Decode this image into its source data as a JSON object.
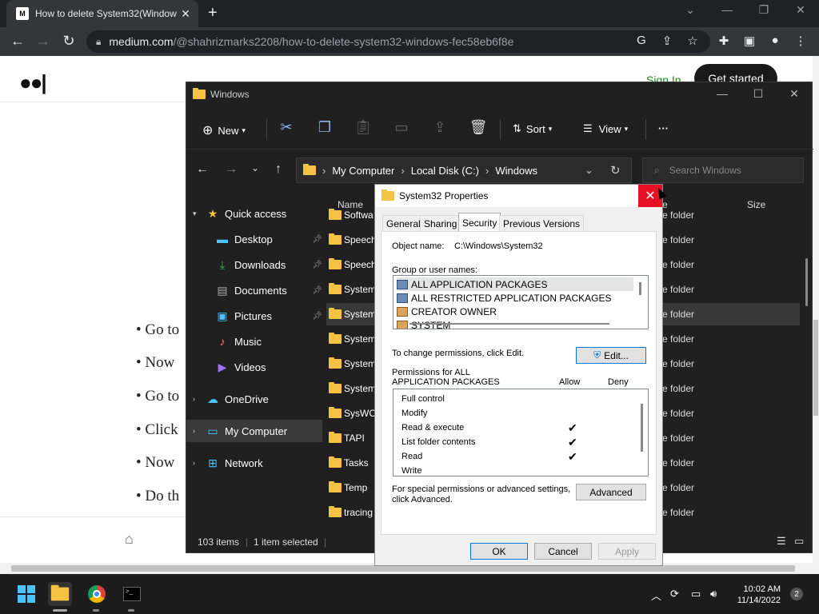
{
  "browser": {
    "tab_title": "How to delete System32(Window",
    "favicon": "M",
    "url_host": "medium.com",
    "url_path": "/@shahrizmarks2208/how-to-delete-system32-windows-fec58eb6f8e"
  },
  "medium": {
    "sign_in": "Sign In",
    "get_started": "Get started",
    "bullets": [
      "Go to",
      "Now",
      "Go to",
      "Click",
      "Now",
      "Do th"
    ]
  },
  "explorer": {
    "title": "Windows",
    "commands": {
      "new": "New",
      "sort": "Sort",
      "view": "View",
      "more": "···"
    },
    "breadcrumb": [
      "My Computer",
      "Local Disk (C:)",
      "Windows"
    ],
    "search_placeholder": "Search Windows",
    "nav": [
      {
        "label": "Quick access",
        "icon": "star-icon"
      },
      {
        "label": "Desktop",
        "icon": "desktop-icon"
      },
      {
        "label": "Downloads",
        "icon": "download-icon"
      },
      {
        "label": "Documents",
        "icon": "document-icon"
      },
      {
        "label": "Pictures",
        "icon": "pictures-icon"
      },
      {
        "label": "Music",
        "icon": "music-icon"
      },
      {
        "label": "Videos",
        "icon": "videos-icon"
      },
      {
        "label": "OneDrive",
        "icon": "cloud-icon"
      },
      {
        "label": "My Computer",
        "icon": "computer-icon"
      },
      {
        "label": "Network",
        "icon": "network-icon"
      }
    ],
    "columns": {
      "name": "Name",
      "type": "e",
      "size": "Size"
    },
    "files": [
      {
        "name": "Softwa",
        "type": "e folder"
      },
      {
        "name": "Speech",
        "type": "e folder"
      },
      {
        "name": "Speech",
        "type": "e folder"
      },
      {
        "name": "System",
        "type": "e folder"
      },
      {
        "name": "System",
        "type": "e folder"
      },
      {
        "name": "System",
        "type": "e folder"
      },
      {
        "name": "System",
        "type": "e folder"
      },
      {
        "name": "System",
        "type": "e folder"
      },
      {
        "name": "SysWO",
        "type": "e folder"
      },
      {
        "name": "TAPI",
        "type": "e folder"
      },
      {
        "name": "Tasks",
        "type": "e folder"
      },
      {
        "name": "Temp",
        "type": "e folder"
      },
      {
        "name": "tracing",
        "type": "e folder"
      }
    ],
    "status": {
      "items": "103 items",
      "selected": "1 item selected"
    }
  },
  "properties": {
    "title": "System32 Properties",
    "tabs": [
      "General",
      "Sharing",
      "Security",
      "Previous Versions"
    ],
    "object_name_label": "Object name:",
    "object_name": "C:\\Windows\\System32",
    "group_label": "Group or user names:",
    "groups": [
      "ALL APPLICATION PACKAGES",
      "ALL RESTRICTED APPLICATION PACKAGES",
      "CREATOR OWNER",
      "SYSTEM"
    ],
    "change_text": "To change permissions, click Edit.",
    "edit_button": "Edit...",
    "perm_label_1": "Permissions for ALL",
    "perm_label_2": "APPLICATION PACKAGES",
    "allow": "Allow",
    "deny": "Deny",
    "permissions": [
      {
        "name": "Full control",
        "allow": ""
      },
      {
        "name": "Modify",
        "allow": ""
      },
      {
        "name": "Read & execute",
        "allow": "✔"
      },
      {
        "name": "List folder contents",
        "allow": "✔"
      },
      {
        "name": "Read",
        "allow": "✔"
      },
      {
        "name": "Write",
        "allow": ""
      }
    ],
    "special_text_1": "For special permissions or advanced settings,",
    "special_text_2": "click Advanced.",
    "advanced_button": "Advanced",
    "ok": "OK",
    "cancel": "Cancel",
    "apply": "Apply"
  },
  "taskbar": {
    "time": "10:02 AM",
    "date": "11/14/2022",
    "notifications": "2"
  }
}
